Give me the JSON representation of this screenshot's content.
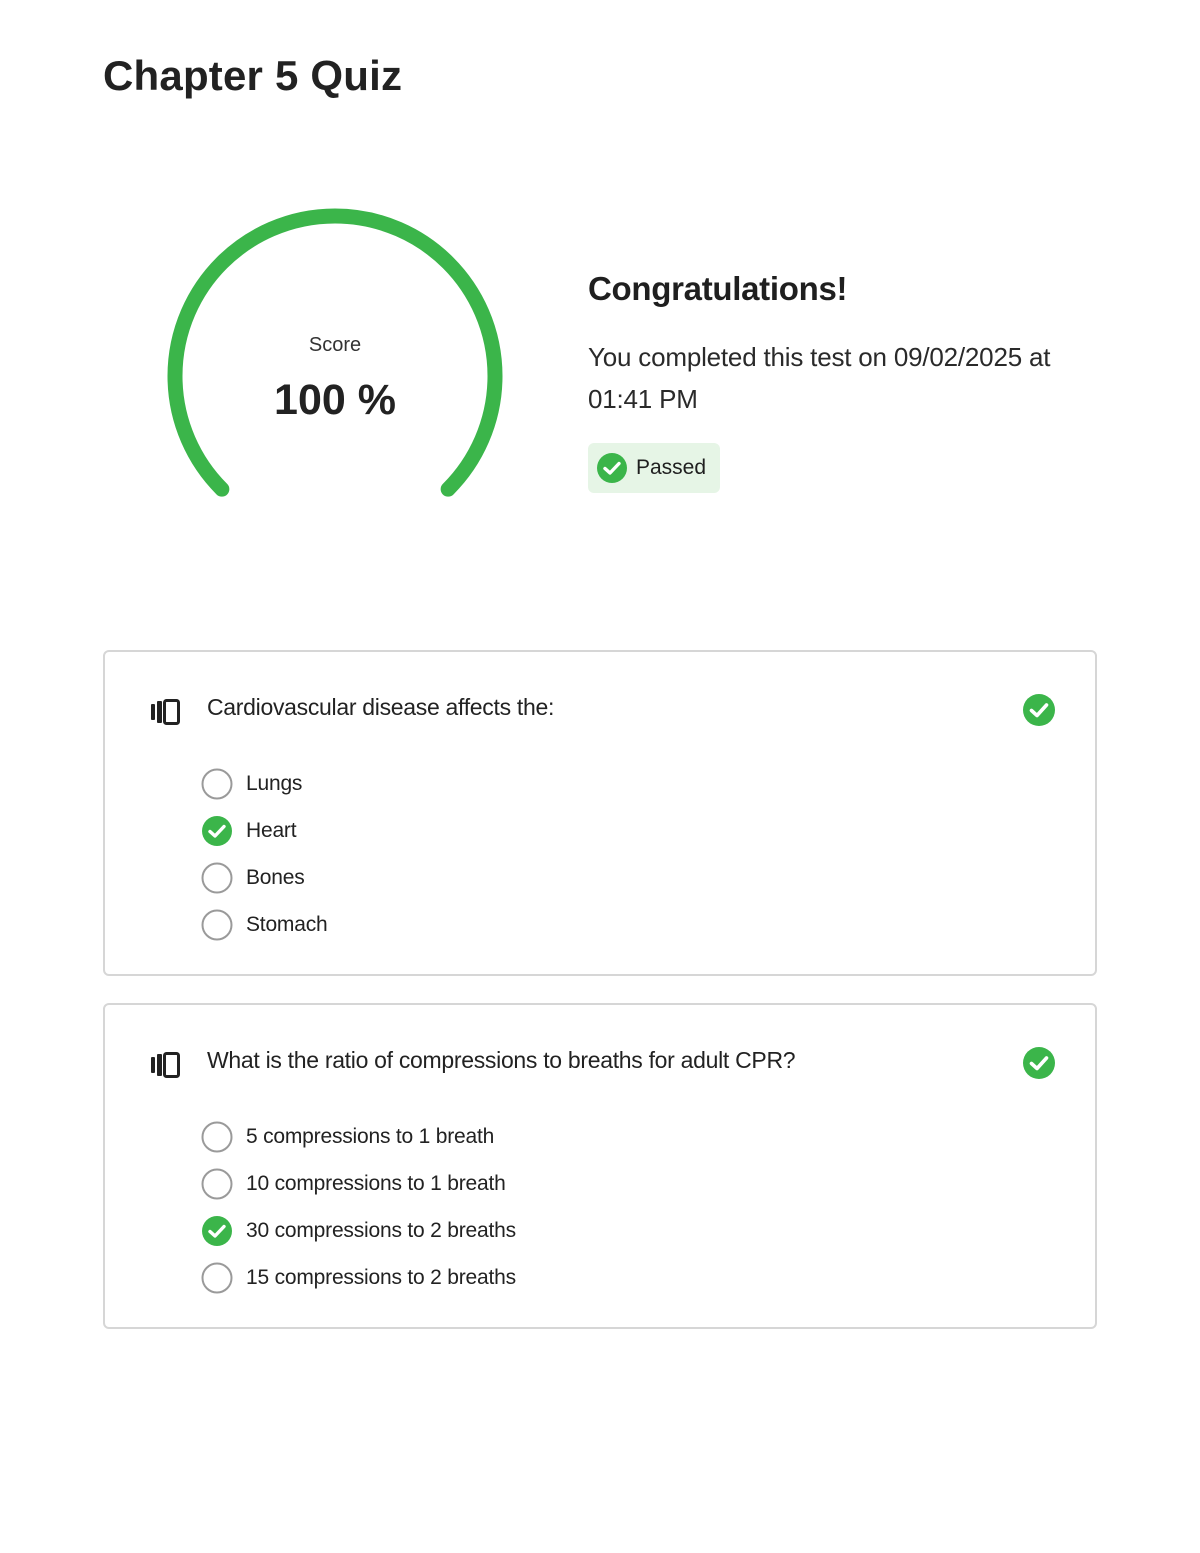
{
  "page": {
    "title": "Chapter 5 Quiz"
  },
  "score": {
    "label": "Score",
    "value_text": "100 %",
    "percent": 100,
    "color": "#3bb54a"
  },
  "result": {
    "heading": "Congratulations!",
    "message": "You completed this test on 09/02/2025 at 01:41 PM",
    "badge": {
      "label": "Passed",
      "icon": "check-circle-icon",
      "background": "#e6f5e6"
    }
  },
  "questions": [
    {
      "text": "Cardiovascular disease affects the:",
      "type_icon": "question-type-icon",
      "status_icon": "check-circle-icon",
      "correct": true,
      "options": [
        {
          "label": "Lungs",
          "selected": false
        },
        {
          "label": "Heart",
          "selected": true
        },
        {
          "label": "Bones",
          "selected": false
        },
        {
          "label": "Stomach",
          "selected": false
        }
      ]
    },
    {
      "text": "What is the ratio of compressions to breaths for adult CPR?",
      "type_icon": "question-type-icon",
      "status_icon": "check-circle-icon",
      "correct": true,
      "options": [
        {
          "label": "5 compressions to 1 breath",
          "selected": false
        },
        {
          "label": "10 compressions to 1 breath",
          "selected": false
        },
        {
          "label": "30 compressions to 2 breaths",
          "selected": true
        },
        {
          "label": "15 compressions to 2 breaths",
          "selected": false
        }
      ]
    }
  ],
  "colors": {
    "accent_green": "#3bb54a",
    "radio_border": "#9a9a9a",
    "card_border": "#d6d6d6"
  }
}
